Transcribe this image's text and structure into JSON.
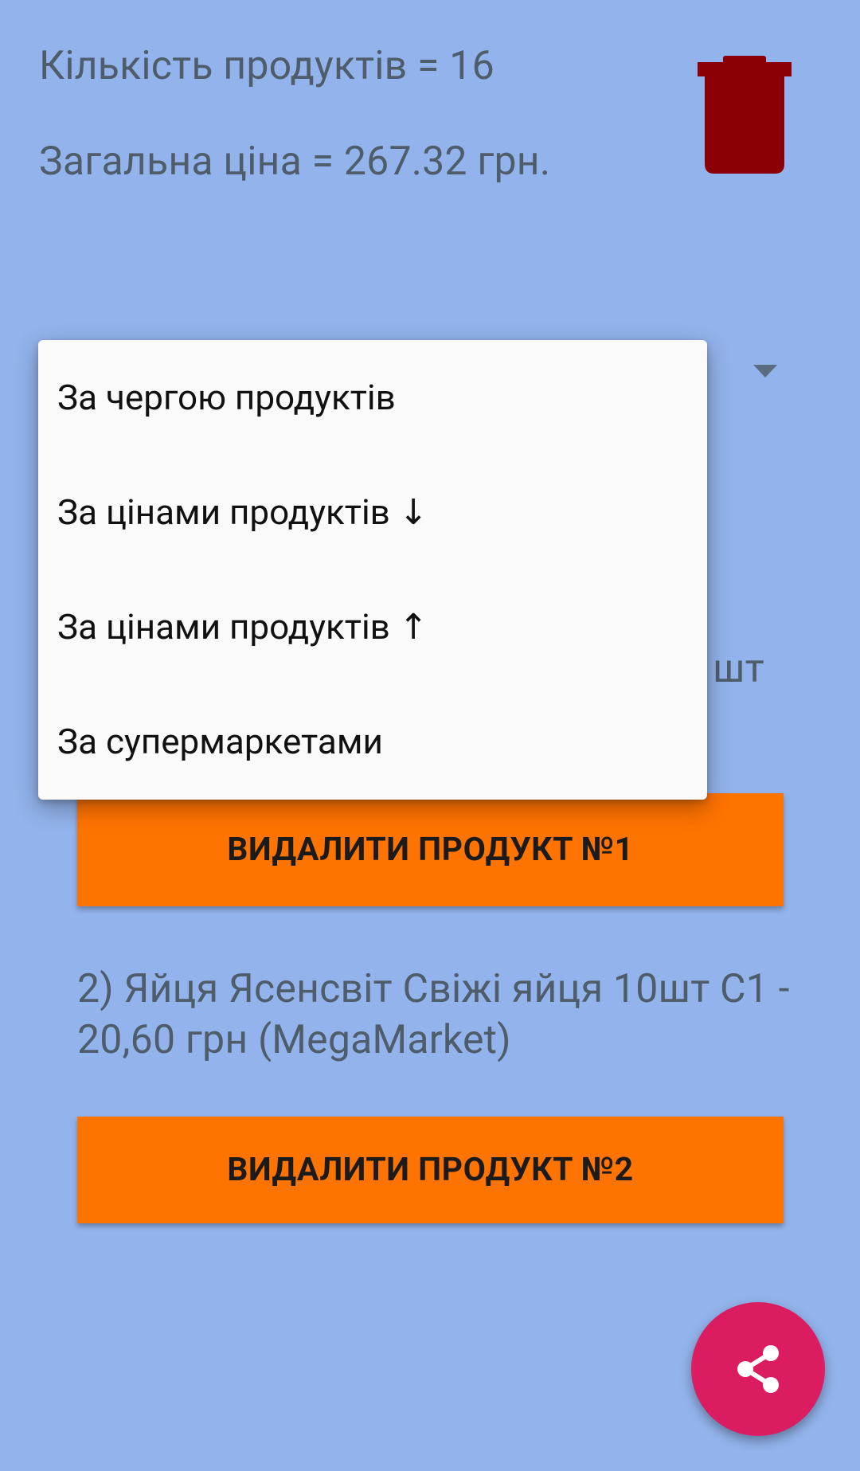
{
  "summary": {
    "count_line": "Кількість продуктів = 16",
    "total_line": "Загальна ціна = 267.32 грн."
  },
  "icons": {
    "trash": "trash-icon",
    "spinner_arrow": "chevron-down-icon",
    "share": "share-icon"
  },
  "colors": {
    "background": "#93b3ec",
    "trash": "#8b0007",
    "delete_button": "#ff7300",
    "fab": "#dc1c60"
  },
  "sort_menu": {
    "options": [
      "За чергою продуктів",
      "За цінами продуктів ↓",
      "За цінами продуктів ↑",
      "За супермаркетами"
    ]
  },
  "products": [
    {
      "visible_text": "шт",
      "delete_label": "ВИДАЛИТИ ПРОДУКТ №1"
    },
    {
      "text": "2) Яйця Ясенсвіт Свіжі яйця 10шт С1 - 20,60 грн (MegaMarket)",
      "delete_label": "ВИДАЛИТИ ПРОДУКТ №2"
    }
  ]
}
